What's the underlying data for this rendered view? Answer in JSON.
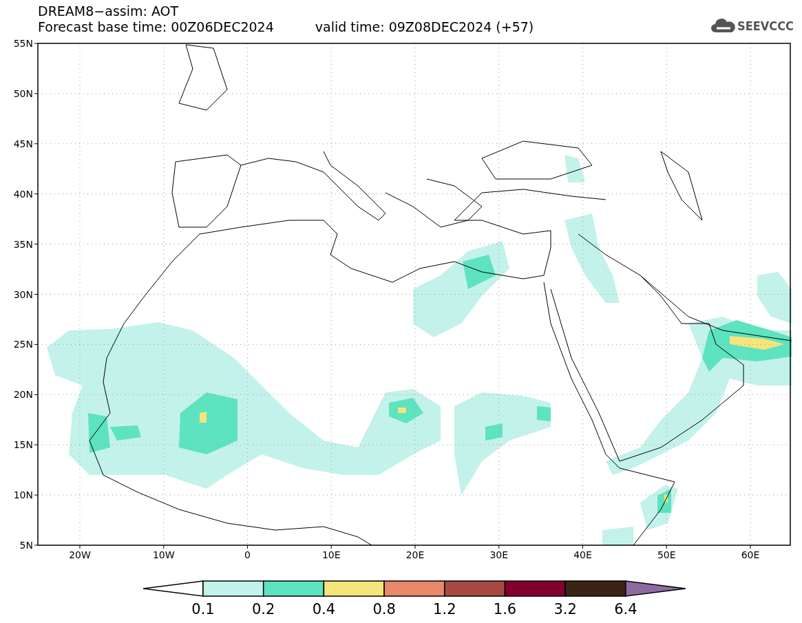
{
  "header": {
    "title": "DREAM8−assim: AOT",
    "base_time": "Forecast base time: 00Z06DEC2024",
    "valid_time": "valid time: 09Z08DEC2024 (+57)"
  },
  "logo": {
    "text": "SEEVCCC"
  },
  "map": {
    "y_ticks": [
      "55N",
      "50N",
      "45N",
      "40N",
      "35N",
      "30N",
      "25N",
      "20N",
      "15N",
      "10N",
      "5N"
    ],
    "x_ticks": [
      "20W",
      "10W",
      "0",
      "10E",
      "20E",
      "30E",
      "40E",
      "50E",
      "60E"
    ]
  },
  "colorbar": {
    "segments": [
      {
        "kind": "arrow-left",
        "color": "#ffffff"
      },
      {
        "kind": "box",
        "color": "#c3f2ea"
      },
      {
        "kind": "box",
        "color": "#5de3bf"
      },
      {
        "kind": "box",
        "color": "#f5e57a"
      },
      {
        "kind": "box",
        "color": "#e8896a"
      },
      {
        "kind": "box",
        "color": "#a84a42"
      },
      {
        "kind": "box",
        "color": "#82002c"
      },
      {
        "kind": "box",
        "color": "#3a2416"
      },
      {
        "kind": "arrow-right",
        "color": "#8e6aa0"
      }
    ],
    "labels": [
      "0.1",
      "0.2",
      "0.4",
      "0.8",
      "1.2",
      "1.6",
      "3.2",
      "6.4"
    ]
  }
}
